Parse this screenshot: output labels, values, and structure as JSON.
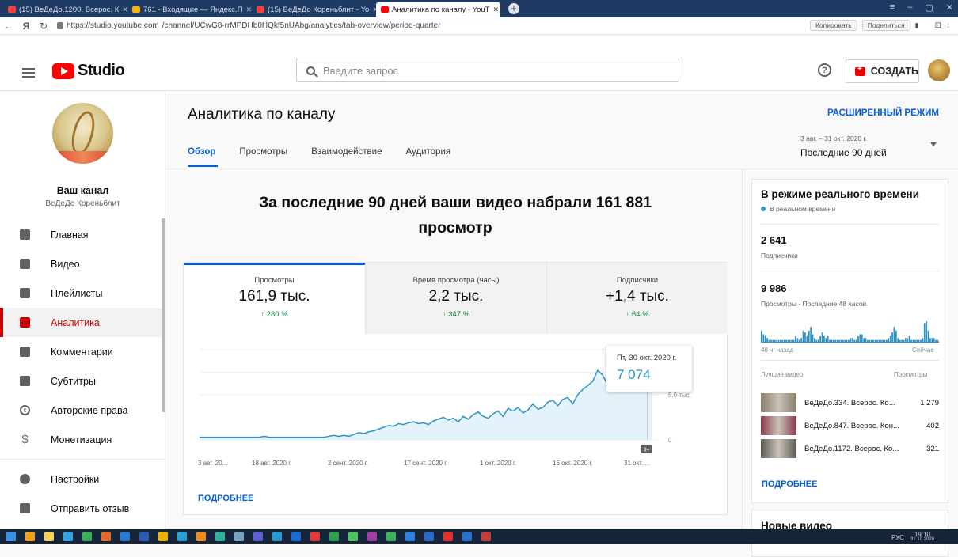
{
  "browser": {
    "tabs": [
      {
        "title": "(15) ВеДеДо.1200. Всерос. К",
        "color": "#ff3d3d",
        "active": false
      },
      {
        "title": "761 - Входящие — Яндекс.П",
        "color": "#f7b500",
        "active": false
      },
      {
        "title": "(15) ВеДеДо Кореньблит - Yo",
        "color": "#ff3d3d",
        "active": false
      },
      {
        "title": "Аналитика по каналу - YouT",
        "color": "#ff0000",
        "active": true
      }
    ],
    "url_host": "https://studio.youtube.com",
    "url_path": "/channel/UCwG8-rrMPDHb0HQkf5nUAbg/analytics/tab-overview/period-quarter",
    "copy_label": "Копировать",
    "share_label": "Поделиться"
  },
  "header": {
    "logo_text": "Studio",
    "search_placeholder": "Введите запрос",
    "create_label": "СОЗДАТЬ"
  },
  "channel": {
    "name": "Ваш канал",
    "subtitle": "ВеДеДо Кореньблит"
  },
  "nav": [
    {
      "label": "Главная",
      "icon": "dashboard-icon",
      "active": false
    },
    {
      "label": "Видео",
      "icon": "video-icon",
      "active": false
    },
    {
      "label": "Плейлисты",
      "icon": "playlist-icon",
      "active": false
    },
    {
      "label": "Аналитика",
      "icon": "analytics-icon",
      "active": true
    },
    {
      "label": "Комментарии",
      "icon": "comments-icon",
      "active": false
    },
    {
      "label": "Субтитры",
      "icon": "subtitles-icon",
      "active": false
    },
    {
      "label": "Авторские права",
      "icon": "copyright-icon",
      "active": false
    },
    {
      "label": "Монетизация",
      "icon": "monetization-icon",
      "active": false
    }
  ],
  "nav_bottom": [
    {
      "label": "Настройки",
      "icon": "settings-icon"
    },
    {
      "label": "Отправить отзыв",
      "icon": "feedback-icon"
    }
  ],
  "main": {
    "title": "Аналитика по каналу",
    "advanced_mode": "РАСШИРЕННЫЙ РЕЖИМ",
    "tabs": [
      "Обзор",
      "Просмотры",
      "Взаимодействие",
      "Аудитория"
    ],
    "date_range": "3 авг. – 31 окт. 2020 г.",
    "period": "Последние 90 дней",
    "headline": "За последние 90 дней ваши видео набрали 161 881 просмотр",
    "more": "ПОДРОБНЕЕ"
  },
  "metrics": [
    {
      "label": "Просмотры",
      "value": "161,9 тыс.",
      "delta": "↑ 280 %"
    },
    {
      "label": "Время просмотра (часы)",
      "value": "2,2 тыс.",
      "delta": "↑ 347 %"
    },
    {
      "label": "Подписчики",
      "value": "+1,4 тыс.",
      "delta": "↑ 64 %"
    }
  ],
  "tooltip": {
    "date": "Пт, 30 окт. 2020 г.",
    "value": "7 074"
  },
  "chart_data": {
    "type": "area",
    "x_tick_labels": [
      "3 авг. 20...",
      "18 авг. 2020 г.",
      "2 сент. 2020 г.",
      "17 сент. 2020 г.",
      "1 окт. 2020 г.",
      "16 окт. 2020 г.",
      "31 окт. ..."
    ],
    "y_tick_labels": [
      "0",
      "5,0 тыс.",
      "с.",
      "с."
    ],
    "ylim": [
      0,
      10000
    ],
    "values": [
      300,
      300,
      300,
      300,
      300,
      300,
      300,
      300,
      300,
      300,
      300,
      300,
      300,
      400,
      300,
      300,
      300,
      300,
      300,
      300,
      300,
      300,
      300,
      300,
      300,
      300,
      400,
      500,
      400,
      500,
      400,
      600,
      800,
      700,
      900,
      1000,
      1200,
      1400,
      1600,
      1500,
      1800,
      1700,
      1900,
      2000,
      1800,
      1900,
      1700,
      2100,
      2300,
      2500,
      2200,
      2400,
      2000,
      2600,
      2300,
      2800,
      3100,
      2600,
      2400,
      2900,
      3200,
      2600,
      3500,
      3200,
      3600,
      3000,
      3300,
      4000,
      3400,
      3600,
      4200,
      4400,
      3800,
      4500,
      4700,
      4000,
      5000,
      5600,
      6000,
      6500,
      7700,
      7200,
      6100,
      7400,
      8200,
      6900,
      6200,
      7300,
      8800,
      7800,
      7074,
      6300
    ],
    "highlight_index": 90,
    "badge": "9+"
  },
  "realtime": {
    "title": "В режиме реального времени",
    "live_label": "В реальном времени",
    "subscribers": "2 641",
    "subscribers_label": "Подписчики",
    "views": "9 986",
    "views_label": "Просмотры · Последние 48 часов",
    "left_label": "48 ч. назад",
    "right_label": "Сейчас",
    "bars": [
      6,
      4,
      3,
      2,
      1,
      1,
      1,
      1,
      1,
      1,
      1,
      1,
      1,
      1,
      1,
      1,
      1,
      1,
      3,
      2,
      1,
      2,
      6,
      5,
      3,
      6,
      8,
      4,
      2,
      1,
      1,
      3,
      5,
      3,
      2,
      3,
      1,
      1,
      1,
      1,
      1,
      1,
      1,
      1,
      1,
      1,
      1,
      2,
      2,
      1,
      1,
      3,
      4,
      4,
      2,
      2,
      1,
      1,
      1,
      1,
      1,
      1,
      1,
      1,
      1,
      1,
      1,
      2,
      3,
      5,
      8,
      6,
      2,
      1,
      1,
      1,
      2,
      2,
      3,
      1,
      1,
      1,
      1,
      1,
      1,
      2,
      10,
      11,
      6,
      2,
      2,
      2,
      1,
      1
    ],
    "top_videos_label": "Лучшие видео",
    "views_col_label": "Просмотры",
    "videos": [
      {
        "title": "ВеДеДо.334. Всерос. Ко...",
        "views": "1 279",
        "thumb": "#8a7d6a"
      },
      {
        "title": "ВеДеДо.847. Всерос. Кон...",
        "views": "402",
        "thumb": "#8a3a4a"
      },
      {
        "title": "ВеДеДо.1172. Всерос. Ко...",
        "views": "321",
        "thumb": "#5d5b55"
      }
    ],
    "more": "ПОДРОБНЕЕ"
  },
  "new_video_title": "Новые видео",
  "taskbar": {
    "lang": "РУС",
    "time": "19:10",
    "date": "31.10.2020"
  }
}
